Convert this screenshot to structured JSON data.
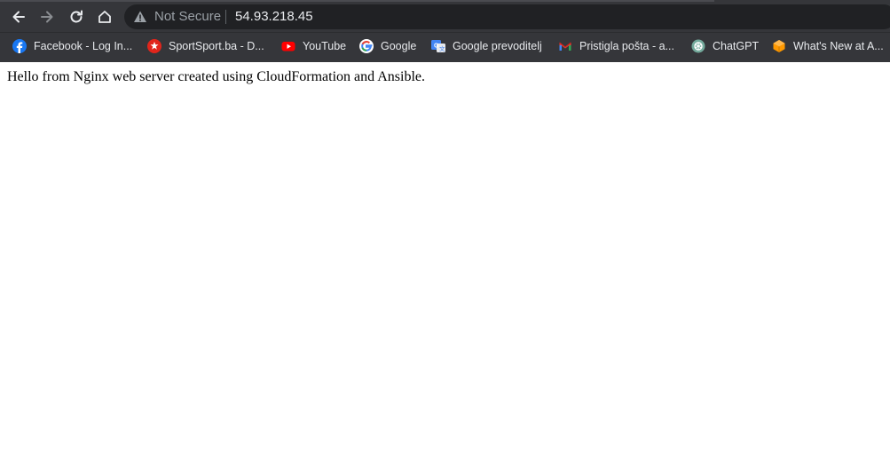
{
  "browser": {
    "security_label": "Not Secure",
    "url": "54.93.218.45",
    "nav": {
      "back_icon": "arrow-left-icon",
      "forward_icon": "arrow-right-icon",
      "reload_icon": "reload-icon",
      "home_icon": "home-icon"
    },
    "colors": {
      "chrome_bg": "#35363a",
      "omnibox_bg": "#202124",
      "text": "#e8eaed",
      "muted_text": "#9aa0a6"
    }
  },
  "bookmarks": [
    {
      "label": "Facebook - Log In...",
      "icon": "facebook-icon"
    },
    {
      "label": "SportSport.ba - D...",
      "icon": "sportsport-icon"
    },
    {
      "label": "YouTube",
      "icon": "youtube-icon"
    },
    {
      "label": "Google",
      "icon": "google-icon"
    },
    {
      "label": "Google prevoditelj",
      "icon": "google-translate-icon"
    },
    {
      "label": "Pristigla pošta - a...",
      "icon": "gmail-icon"
    },
    {
      "label": "ChatGPT",
      "icon": "chatgpt-icon"
    },
    {
      "label": "What's New at A...",
      "icon": "aws-icon"
    }
  ],
  "page": {
    "body_text": "Hello from Nginx web server created using CloudFormation and Ansible."
  }
}
